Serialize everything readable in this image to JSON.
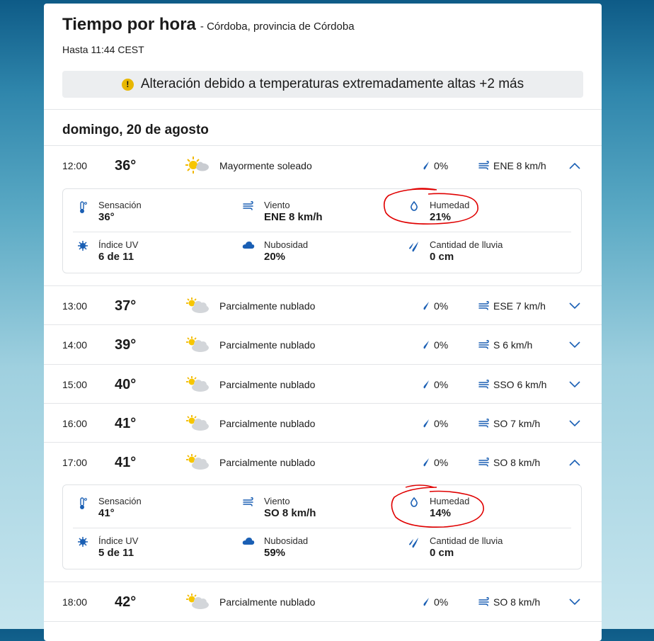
{
  "header": {
    "title": "Tiempo por hora",
    "location": "- Córdoba, provincia de Córdoba",
    "until": "Hasta 11:44 CEST"
  },
  "alert": {
    "text": "Alteración debido a temperaturas extremadamente altas +2 más"
  },
  "date": "domingo, 20 de agosto",
  "rows": [
    {
      "time": "12:00",
      "temp": "36°",
      "icon": "mostly-sunny-icon",
      "condition": "Mayormente soleado",
      "precip": "0%",
      "wind": "ENE 8 km/h",
      "expanded": true
    },
    {
      "time": "13:00",
      "temp": "37°",
      "icon": "partly-cloudy-icon",
      "condition": "Parcialmente nublado",
      "precip": "0%",
      "wind": "ESE 7 km/h",
      "expanded": false
    },
    {
      "time": "14:00",
      "temp": "39°",
      "icon": "partly-cloudy-icon",
      "condition": "Parcialmente nublado",
      "precip": "0%",
      "wind": "S 6 km/h",
      "expanded": false
    },
    {
      "time": "15:00",
      "temp": "40°",
      "icon": "partly-cloudy-icon",
      "condition": "Parcialmente nublado",
      "precip": "0%",
      "wind": "SSO 6 km/h",
      "expanded": false
    },
    {
      "time": "16:00",
      "temp": "41°",
      "icon": "partly-cloudy-icon",
      "condition": "Parcialmente nublado",
      "precip": "0%",
      "wind": "SO 7 km/h",
      "expanded": false
    },
    {
      "time": "17:00",
      "temp": "41°",
      "icon": "partly-cloudy-icon",
      "condition": "Parcialmente nublado",
      "precip": "0%",
      "wind": "SO 8 km/h",
      "expanded": true
    },
    {
      "time": "18:00",
      "temp": "42°",
      "icon": "partly-cloudy-icon",
      "condition": "Parcialmente nublado",
      "precip": "0%",
      "wind": "SO 8 km/h",
      "expanded": false
    }
  ],
  "details": [
    {
      "feels_label": "Sensación",
      "feels": "36°",
      "wind_label": "Viento",
      "wind": "ENE 8 km/h",
      "humidity_label": "Humedad",
      "humidity": "21%",
      "uv_label": "Índice UV",
      "uv": "6 de 11",
      "cloud_label": "Nubosidad",
      "cloud": "20%",
      "rain_label": "Cantidad de lluvia",
      "rain": "0 cm"
    },
    {
      "feels_label": "Sensación",
      "feels": "41°",
      "wind_label": "Viento",
      "wind": "SO 8 km/h",
      "humidity_label": "Humedad",
      "humidity": "14%",
      "uv_label": "Índice UV",
      "uv": "5 de 11",
      "cloud_label": "Nubosidad",
      "cloud": "59%",
      "rain_label": "Cantidad de lluvia",
      "rain": "0 cm"
    }
  ],
  "colors": {
    "accent": "#1a5fb4",
    "alert": "#e8b700",
    "annotation": "#e00000"
  }
}
